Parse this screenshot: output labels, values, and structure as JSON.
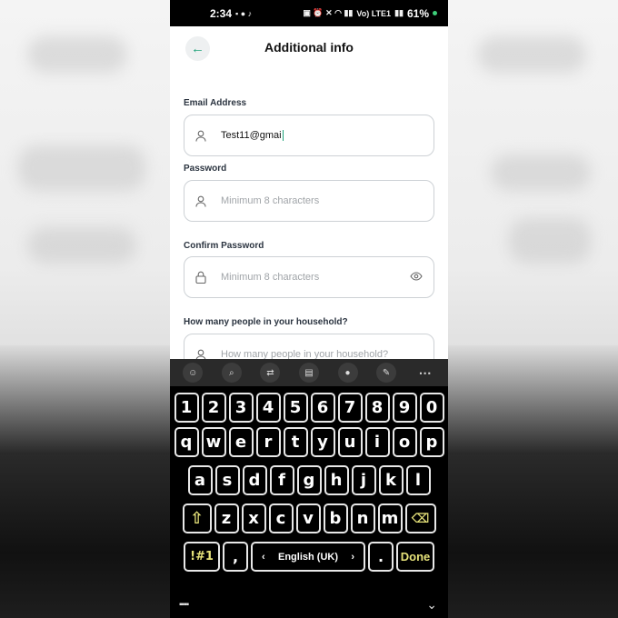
{
  "status_bar": {
    "time": "2:34",
    "carrier_small": "Vo) LTE1",
    "battery": "61%"
  },
  "header": {
    "title": "Additional info",
    "back_icon": "arrow-left-icon"
  },
  "form": {
    "email": {
      "label": "Email Address",
      "value": "Test11@gmai",
      "icon": "user-icon"
    },
    "password": {
      "label": "Password",
      "placeholder": "Minimum 8 characters",
      "icon": "user-icon"
    },
    "confirm_password": {
      "label": "Confirm Password",
      "placeholder": "Minimum 8 characters",
      "icon": "lock-icon",
      "trailing_icon": "eye-icon"
    },
    "household": {
      "label": "How many people in your household?",
      "placeholder": "How many people in your household?",
      "icon": "user-icon"
    }
  },
  "keyboard": {
    "toolbar": [
      "emoji-icon",
      "search-icon",
      "translate-icon",
      "clipboard-icon",
      "mic-icon",
      "handwriting-icon",
      "more-icon"
    ],
    "row_numbers": [
      "1",
      "2",
      "3",
      "4",
      "5",
      "6",
      "7",
      "8",
      "9",
      "0"
    ],
    "row_top": [
      "q",
      "w",
      "e",
      "r",
      "t",
      "y",
      "u",
      "i",
      "o",
      "p"
    ],
    "row_mid": [
      "a",
      "s",
      "d",
      "f",
      "g",
      "h",
      "j",
      "k",
      "l"
    ],
    "row_bottom": [
      "z",
      "x",
      "c",
      "v",
      "b",
      "n",
      "m"
    ],
    "sym_label": "!#1",
    "comma": ",",
    "space_label": "English (UK)",
    "period": ".",
    "done_label": "Done"
  },
  "colors": {
    "accent": "#1fa37a",
    "key_highlight": "#e7e37a"
  }
}
